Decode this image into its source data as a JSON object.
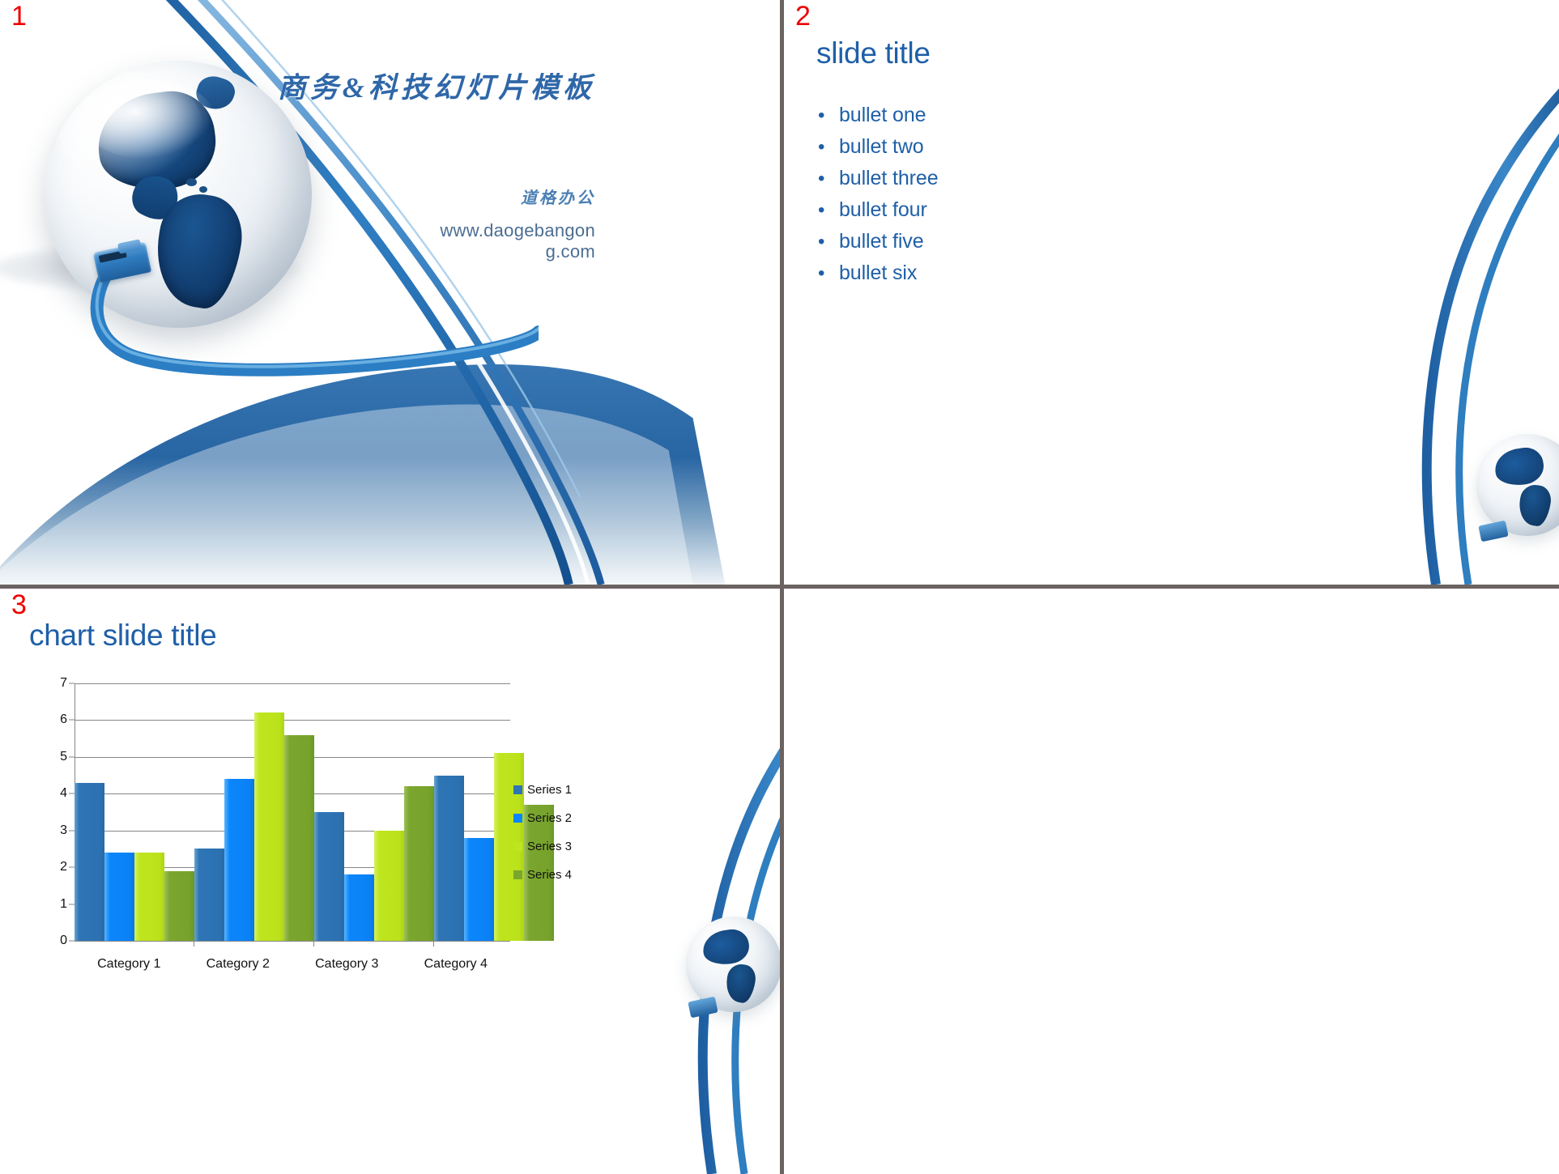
{
  "deck": {
    "slides": [
      {
        "number": "1",
        "kind": "title-slide",
        "title": "商务&科技幻灯片模板",
        "subtitle": "道格办公",
        "url": "www.daogebangong.com",
        "artwork": "globe-with-ethernet-cable"
      },
      {
        "number": "2",
        "kind": "bullet-slide",
        "title": "slide title",
        "bullets": [
          "bullet one",
          "bullet two",
          "bullet three",
          "bullet four",
          "bullet five",
          "bullet six"
        ],
        "bullet_marker": "•"
      },
      {
        "number": "3",
        "kind": "chart-slide",
        "title": "chart slide title"
      },
      {
        "number": "",
        "kind": "blank-slide"
      }
    ]
  },
  "colors": {
    "slide_number": "#ee0000",
    "title_blue": "#1f5fa8",
    "body_blue": "#1f5fa8",
    "accent_blue": "#2f67a8",
    "url_blue": "#4b6e93",
    "divider_gray": "#6b6361",
    "series_1": "#2e75b6",
    "series_2": "#0a84fa",
    "series_3": "#bfe51e",
    "series_4": "#7aa62e",
    "grid": "#868686",
    "axis_text": "#111111"
  },
  "chart_data": {
    "type": "bar",
    "title": "chart slide title",
    "xlabel": "",
    "ylabel": "",
    "ylim": [
      0,
      7
    ],
    "yticks": [
      0,
      1,
      2,
      3,
      4,
      5,
      6,
      7
    ],
    "grid": true,
    "legend_position": "right",
    "categories": [
      "Category 1",
      "Category 2",
      "Category 3",
      "Category 4"
    ],
    "series": [
      {
        "name": "Series 1",
        "color": "#2e75b6",
        "values": [
          4.3,
          2.5,
          3.5,
          4.5
        ]
      },
      {
        "name": "Series 2",
        "color": "#0a84fa",
        "values": [
          2.4,
          4.4,
          1.8,
          2.8
        ]
      },
      {
        "name": "Series 3",
        "color": "#bfe51e",
        "values": [
          2.4,
          6.2,
          3.0,
          5.1
        ]
      },
      {
        "name": "Series 4",
        "color": "#7aa62e",
        "values": [
          1.9,
          5.6,
          4.2,
          3.7
        ]
      }
    ]
  }
}
